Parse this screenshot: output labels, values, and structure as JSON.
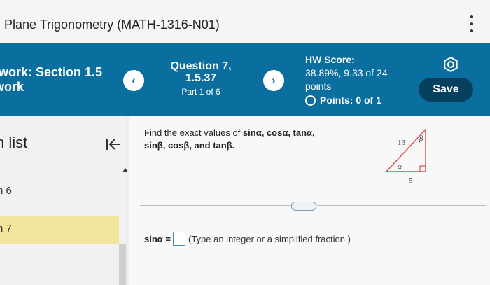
{
  "topbar": {
    "course_title": "Plane Trigonometry (MATH-1316-N01)"
  },
  "header": {
    "hw_title_prefix": "work:",
    "hw_title_section": "Section 1.5",
    "hw_title_sub": "work",
    "question_title": "Question 7,",
    "question_number": "1.5.37",
    "question_part": "Part 1 of 6",
    "score_label": "HW Score:",
    "score_value": "38.89%, 9.33 of 24",
    "score_unit": "points",
    "points_label": "Points: 0 of 1",
    "save_label": "Save",
    "prev_symbol": "‹",
    "next_symbol": "›"
  },
  "sidebar": {
    "list_label": "n list",
    "items": [
      {
        "label": "n 6"
      },
      {
        "label": "n 7"
      }
    ]
  },
  "question": {
    "prompt_start": "Find the exact values of ",
    "prompt_terms_line1": "sinα, cosα, tanα,",
    "prompt_terms_line2": "sinβ, cosβ, and tanβ.",
    "more_label": "....",
    "answer_label": "sinα =",
    "answer_value": "",
    "answer_hint": "(Type an integer or a simplified fraction.)"
  },
  "triangle": {
    "hypotenuse_label": "13",
    "base_label": "5",
    "angle_alpha": "α",
    "angle_beta": "β",
    "stroke_color": "#d9534f"
  },
  "colors": {
    "header_bg": "#0a6e9e",
    "save_bg": "#07405f",
    "highlight": "#f2e49a"
  }
}
